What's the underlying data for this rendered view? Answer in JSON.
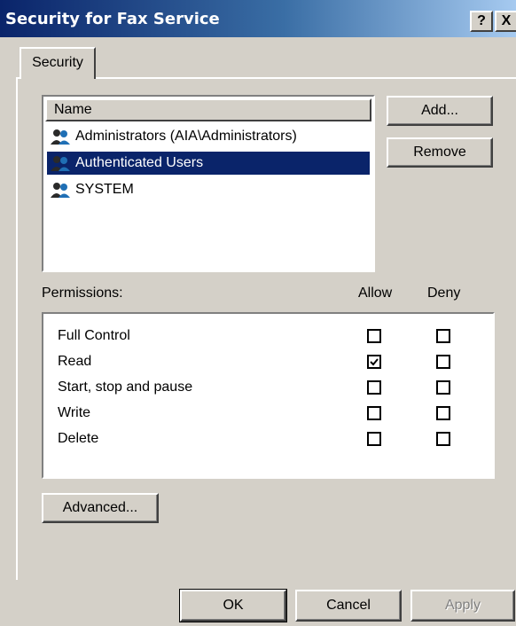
{
  "window": {
    "title": "Security for Fax Service",
    "help_label": "?",
    "close_label": "X"
  },
  "tabs": [
    {
      "label": "Security"
    }
  ],
  "users": {
    "header": "Name",
    "items": [
      {
        "name": "Administrators (AIA\\Administrators)",
        "selected": false
      },
      {
        "name": "Authenticated Users",
        "selected": true
      },
      {
        "name": "SYSTEM",
        "selected": false
      }
    ]
  },
  "buttons": {
    "add": "Add...",
    "remove": "Remove",
    "advanced": "Advanced...",
    "ok": "OK",
    "cancel": "Cancel",
    "apply": "Apply"
  },
  "permissions": {
    "label": "Permissions:",
    "allow_header": "Allow",
    "deny_header": "Deny",
    "rows": [
      {
        "name": "Full Control",
        "allow": false,
        "deny": false
      },
      {
        "name": "Read",
        "allow": true,
        "deny": false
      },
      {
        "name": "Start, stop and pause",
        "allow": false,
        "deny": false
      },
      {
        "name": "Write",
        "allow": false,
        "deny": false
      },
      {
        "name": "Delete",
        "allow": false,
        "deny": false
      }
    ]
  },
  "colors": {
    "selection": "#0a246a",
    "dialog_bg": "#d4d0c8"
  }
}
